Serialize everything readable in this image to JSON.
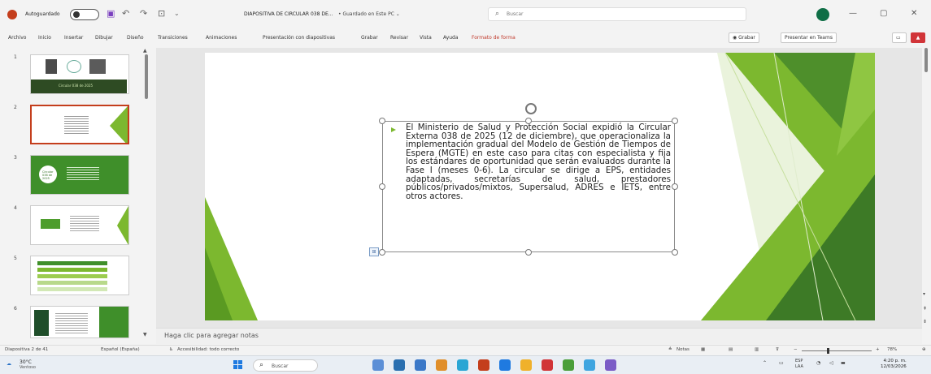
{
  "window": {
    "autosave_label": "Autoguardado",
    "autosave_state": "●",
    "doc_title": "DIAPOSITIVA DE CIRCULAR 038 DE...",
    "saved_status": "• Guardado en Este PC ⌄",
    "search_placeholder": "Buscar",
    "controls": [
      "—",
      "▢",
      "✕"
    ]
  },
  "ribbon": {
    "tabs": [
      "Archivo",
      "Inicio",
      "Insertar",
      "Dibujar",
      "Diseño",
      "Transiciones",
      "Animaciones",
      "Presentación con diapositivas",
      "Grabar",
      "Revisar",
      "Vista",
      "Ayuda",
      "Formato de forma"
    ],
    "record_btn": "◉ Grabar",
    "teams_btn": "Presentar en Teams",
    "comment_icon": "comment-icon",
    "share_btn": "▲"
  },
  "thumbnails": [
    {
      "num": "1",
      "caption": "Circular 038 de 2025"
    },
    {
      "num": "2"
    },
    {
      "num": "3",
      "caption": "Circular 038 de 2025"
    },
    {
      "num": "4"
    },
    {
      "num": "5"
    },
    {
      "num": "6"
    }
  ],
  "slide": {
    "body_text": "El Ministerio de Salud y Protección Social expidió la Circular Externa 038 de 2025 (12 de diciembre), que operacionaliza la implementación gradual del Modelo de Gestión de Tiempos de Espera (MGTE) en este caso para citas con especialista y fija los estándares de oportunidad que serán evaluados durante la Fase I (meses 0-6). La circular se dirige a EPS, entidades adaptadas, secretarías de salud, prestadores públicos/privados/mixtos, Supersalud, ADRES e IETS, entre otros actores.",
    "accent_color": "#7cb82f",
    "dark_green": "#2e6e1e"
  },
  "notes_placeholder": "Haga clic para agregar notas",
  "status": {
    "slide_count": "Diapositiva 2 de 41",
    "language": "Español (España)",
    "accessibility": "Accesibilidad: todo correcto",
    "notes_btn": "Notas",
    "zoom": "78%"
  },
  "taskbar": {
    "temp": "30°C",
    "weather": "Ventoso",
    "search": "Buscar",
    "lang": "ESP",
    "lang_sub": "LAA",
    "time": "4:20 p. m.",
    "date": "12/03/2026"
  }
}
